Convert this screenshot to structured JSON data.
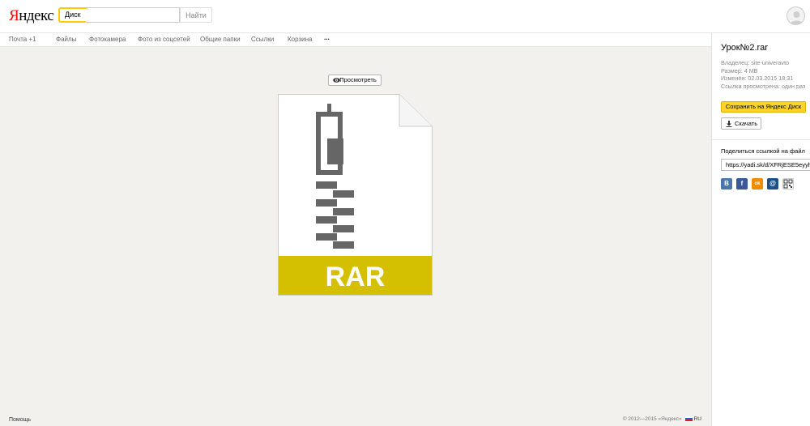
{
  "header": {
    "logo_first": "Я",
    "logo_rest": "ндекс",
    "service": "Диск",
    "search_placeholder": "",
    "search_button": "Найти"
  },
  "nav": {
    "items": [
      "Почта +1",
      "Файлы",
      "Фотокамера",
      "Фото из соцсетей",
      "Общие папки",
      "Ссылки",
      "Корзина"
    ],
    "more": "..."
  },
  "preview": {
    "button_label": "Просмотреть",
    "file_type": "RAR"
  },
  "sidebar": {
    "file_name": "Урок№2.rar",
    "owner": "Владелец: site-univeravto",
    "size": "Размер: 4 MB",
    "modified": "Изменён: 02.03.2015 18:31",
    "views": "Ссылка просмотрена: один раз",
    "save_button": "Сохранить на Яндекс Диск",
    "download_button": "Скачать",
    "share_label": "Поделиться ссылкой на файл",
    "share_url": "https://yadi.sk/d/XFRjESE5eyyh",
    "social": [
      {
        "name": "vk",
        "glyph": "B",
        "color": "#4a76a8"
      },
      {
        "name": "facebook",
        "glyph": "f",
        "color": "#3b5998"
      },
      {
        "name": "odnoklassniki",
        "glyph": "ok",
        "color": "#f08c00"
      },
      {
        "name": "mail",
        "glyph": "@",
        "color": "#1a4f8b"
      },
      {
        "name": "qr",
        "glyph": "",
        "color": "#ffffff"
      }
    ]
  },
  "footer": {
    "help": "Помощь",
    "copyright": "© 2012—2015 «Яндекс»",
    "lang": "RU"
  },
  "colors": {
    "accent_yellow": "#ffd42a",
    "rar_band": "#d4c000",
    "zipper": "#666666",
    "background": "#f3f1ee"
  }
}
